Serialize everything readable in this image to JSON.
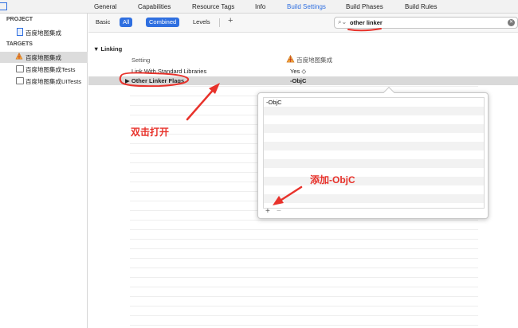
{
  "tabs": [
    "General",
    "Capabilities",
    "Resource Tags",
    "Info",
    "Build Settings",
    "Build Phases",
    "Build Rules"
  ],
  "active_tab": "Build Settings",
  "sidebar": {
    "project_header": "PROJECT",
    "project_item": "百度地图集成",
    "targets_header": "TARGETS",
    "targets": [
      "百度地图集成",
      "百度地图集成Tests",
      "百度地图集成UITests"
    ]
  },
  "filter": {
    "basic": "Basic",
    "all": "All",
    "combined": "Combined",
    "levels": "Levels",
    "add": "+",
    "search_value": "other linker"
  },
  "settings": {
    "section": "Linking",
    "header_setting": "Setting",
    "header_target": "百度地图集成",
    "row1_name": "Link With Standard Libraries",
    "row1_value": "Yes ◇",
    "row2_name": "Other Linker Flags",
    "row2_value": "-ObjC"
  },
  "popover": {
    "entry": "-ObjC",
    "add": "+",
    "remove": "−"
  },
  "annotations": {
    "double_click": "双击打开",
    "add_objc": "添加-ObjC"
  },
  "colors": {
    "accent": "#2f6fe0",
    "annotation": "#e8322b"
  }
}
